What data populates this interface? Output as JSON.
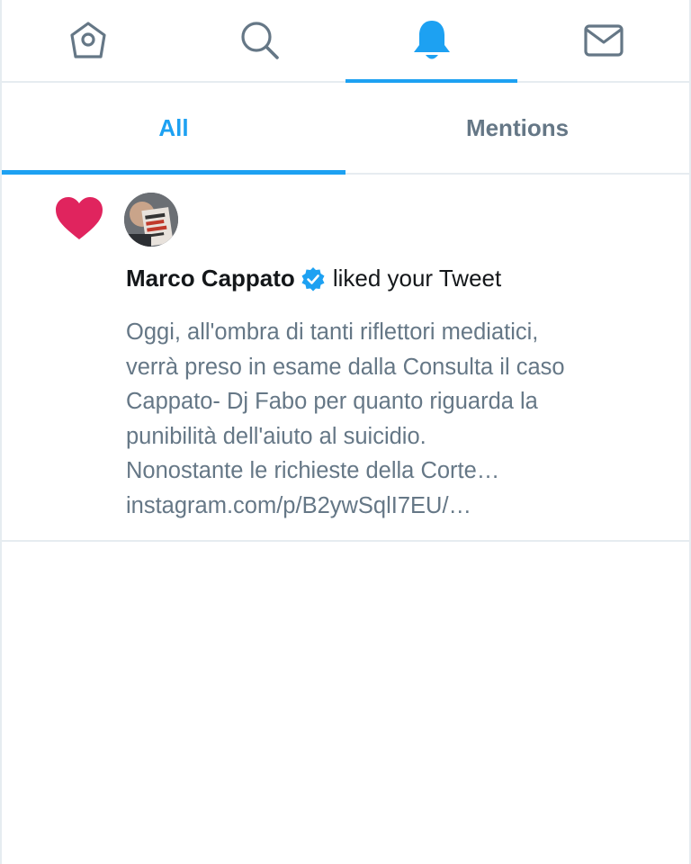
{
  "nav": {
    "tabs": [
      {
        "icon": "home-icon",
        "label": "Home"
      },
      {
        "icon": "search-icon",
        "label": "Search"
      },
      {
        "icon": "bell-icon",
        "label": "Notifications"
      },
      {
        "icon": "mail-icon",
        "label": "Messages"
      }
    ],
    "active_index": 2
  },
  "subtabs": {
    "all": "All",
    "mentions": "Mentions",
    "active": "All"
  },
  "notification": {
    "type_icon": "heart-icon",
    "user_name": "Marco Cappato",
    "verified": true,
    "action": "liked your Tweet",
    "tweet_lines": [
      "Oggi, all'ombra di tanti riflettori mediatici,",
      "verrà preso  in esame dalla Consulta il caso",
      "Cappato- Dj Fabo per quanto riguarda la",
      "punibilità dell'aiuto al suicidio.",
      "Nonostante le richieste della Corte…",
      "instagram.com/p/B2ywSqlI7EU/…"
    ]
  },
  "colors": {
    "accent": "#1da1f2",
    "heart": "#e0245e",
    "secondary_text": "#657786",
    "primary_text": "#14171a",
    "divider": "#e6ecf0"
  }
}
